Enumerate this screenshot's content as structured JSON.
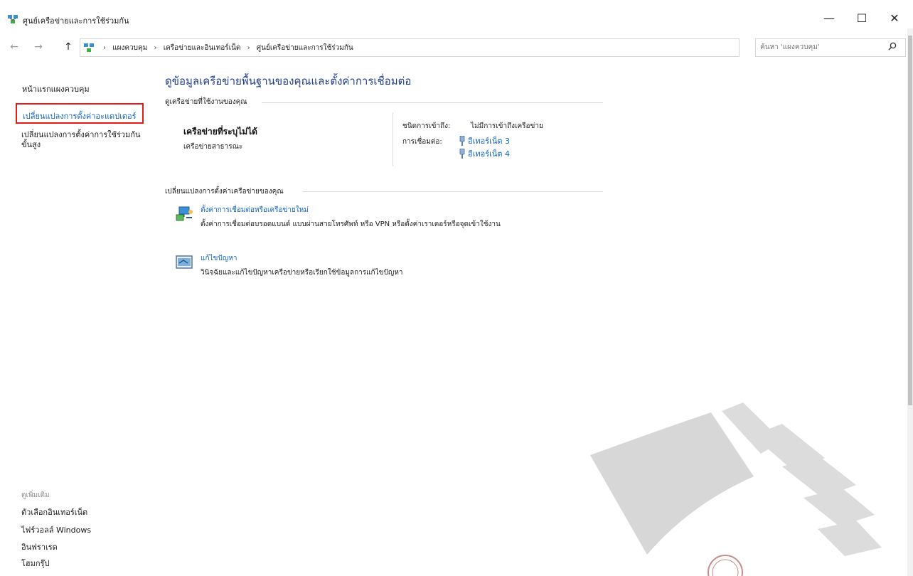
{
  "window": {
    "title": "ศูนย์เครือข่ายและการใช้ร่วมกัน",
    "minimize": "—",
    "maximize": "☐",
    "close": "✕"
  },
  "nav": {
    "back": "←",
    "forward": "→",
    "up": "↑",
    "breadcrumbs": [
      "แผงควบคุม",
      "เครือข่ายและอินเทอร์เน็ต",
      "ศูนย์เครือข่ายและการใช้ร่วมกัน"
    ],
    "separator": "›",
    "dropdown": "⌄",
    "refresh": "↻"
  },
  "search": {
    "placeholder": "ค้นหา 'แผงควบคุม'",
    "icon": "search-icon"
  },
  "sidebar": {
    "home": "หน้าแรกแผงควบคุม",
    "change_adapter": "เปลี่ยนแปลงการตั้งค่าอะแดปเตอร์",
    "change_advanced": "เปลี่ยนแปลงการตั้งค่าการใช้ร่วมกันขั้นสูง",
    "see_also": "ดูเพิ่มเติม",
    "links": [
      "ตัวเลือกอินเทอร์เน็ต",
      "ไฟร์วอลล์ Windows",
      "อินฟราเรด",
      "โฮมกรุ๊ป"
    ]
  },
  "main": {
    "title": "ดูข้อมูลเครือข่ายพื้นฐานของคุณและตั้งค่าการเชื่อมต่อ",
    "active_section": "ดูเครือข่ายที่ใช้งานของคุณ",
    "network_name": "เครือข่ายที่ระบุไม่ได้",
    "network_type": "เครือข่ายสาธารณะ",
    "access_label": "ชนิดการเข้าถึง:",
    "access_value": "ไม่มีการเข้าถึงเครือข่าย",
    "connections_label": "การเชื่อมต่อ:",
    "connections": [
      "อีเทอร์เน็ต 3",
      "อีเทอร์เน็ต 4"
    ],
    "change_section": "เปลี่ยนแปลงการตั้งค่าเครือข่ายของคุณ",
    "tasks": [
      {
        "link": "ตั้งค่าการเชื่อมต่อหรือเครือข่ายใหม่",
        "desc": "ตั้งค่าการเชื่อมต่อบรอดแบนด์ แบบผ่านสายโทรศัพท์ หรือ VPN หรือตั้งค่าเราเตอร์หรือจุดเข้าใช้งาน"
      },
      {
        "link": "แก้ไขปัญหา",
        "desc": "วินิจฉัยและแก้ไขปัญหาเครือข่ายหรือเรียกใช้ข้อมูลการแก้ไขปัญหา"
      }
    ]
  },
  "colors": {
    "link": "#1565c0",
    "title": "#1e3d8f",
    "highlight_border": "#e11a1a"
  }
}
